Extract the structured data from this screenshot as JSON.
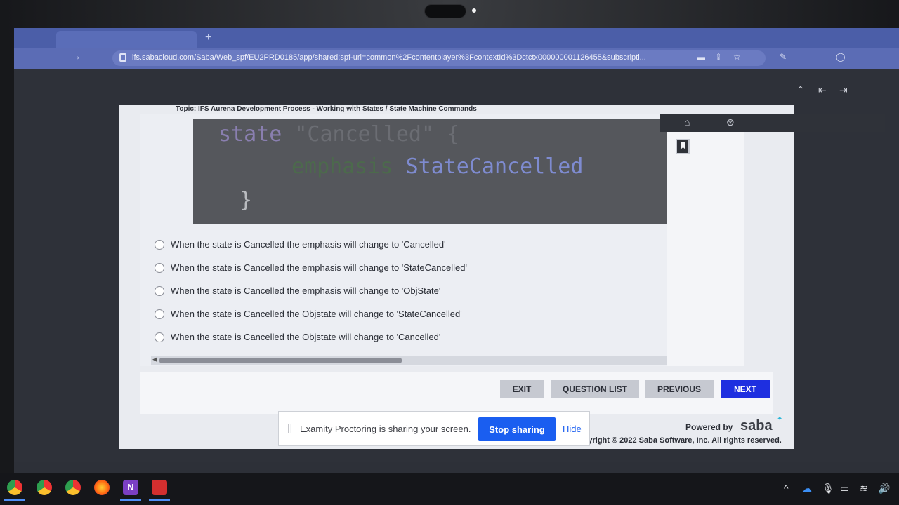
{
  "browser": {
    "url": "ifs.sabacloud.com/Saba/Web_spf/EU2PRD0185/app/shared;spf-url=common%2Fcontentplayer%3FcontextId%3Dctctx000000001126455&subscripti..."
  },
  "topic": "Topic: IFS Aurena Development Process - Working with States / State Machine Commands",
  "code": {
    "line1_keyword": "state",
    "line1_value": "\"Cancelled\" {",
    "line2_keyword": "emphasis",
    "line2_value": "StateCancelled",
    "line3": "}"
  },
  "options": [
    {
      "label": "When the state is Cancelled the emphasis will change to 'Cancelled'"
    },
    {
      "label": "When the state is Cancelled the emphasis will change to 'StateCancelled'"
    },
    {
      "label": "When the state is Cancelled the emphasis will change to 'ObjState'"
    },
    {
      "label": "When the state is Cancelled the Objstate will change to 'StateCancelled'"
    },
    {
      "label": "When the state is Cancelled the Objstate will change to 'Cancelled'"
    }
  ],
  "buttons": {
    "exit": "EXIT",
    "question_list": "QUESTION LIST",
    "previous": "PREVIOUS",
    "next": "NEXT"
  },
  "footer": {
    "powered_by": "Powered by",
    "logo": "saba",
    "copyright": "Copyright © 2022 Saba Software, Inc. All rights reserved."
  },
  "share_banner": {
    "message": "Examity Proctoring is sharing your screen.",
    "stop": "Stop sharing",
    "hide": "Hide"
  },
  "colors": {
    "next_button": "#1e2fe0",
    "stop_button": "#1a5ef0",
    "browser_chrome": "#5b6cb5"
  }
}
